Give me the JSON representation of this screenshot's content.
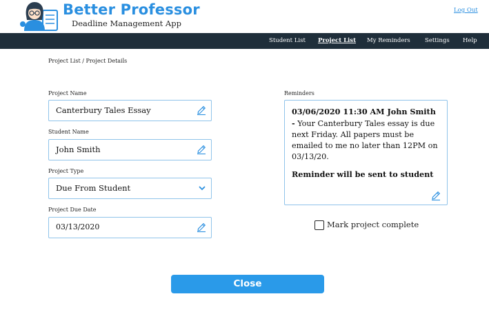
{
  "header": {
    "brand_title": "Better Professor",
    "brand_subtitle": "Deadline Management App",
    "logout_label": "Log Out",
    "logo_icon": "professor-avatar-icon"
  },
  "nav": {
    "items": [
      {
        "label": "Student List"
      },
      {
        "label": "Project List",
        "active": true
      },
      {
        "label": "My Reminders"
      },
      {
        "label": "Settings"
      },
      {
        "label": "Help"
      }
    ]
  },
  "breadcrumb": "Project List / Project Details",
  "form": {
    "project_name": {
      "label": "Project Name",
      "value": "Canterbury Tales Essay",
      "icon": "pencil-icon"
    },
    "student_name": {
      "label": "Student Name",
      "value": "John Smith",
      "icon": "pencil-icon"
    },
    "project_type": {
      "label": "Project Type",
      "value": "Due From Student",
      "icon": "chevron-down-icon"
    },
    "due_date": {
      "label": "Project Due Date",
      "value": "03/13/2020",
      "icon": "pencil-icon"
    }
  },
  "reminders": {
    "label": "Reminders",
    "heading": "03/06/2020 11:30 AM John Smith -",
    "body": "Your Canterbury Tales essay is due next Friday. All papers must be emailed to me no later than 12PM on 03/13/20.",
    "footer": "Reminder will be sent to student",
    "icon": "pencil-icon"
  },
  "mark_complete": {
    "label": "Mark project complete",
    "checked": false
  },
  "close_button": {
    "label": "Close"
  },
  "colors": {
    "brand_blue": "#2a8fe0",
    "nav_bg": "#1f2e3a",
    "field_border": "#8fc3ea",
    "button_blue": "#2a9ae9"
  }
}
